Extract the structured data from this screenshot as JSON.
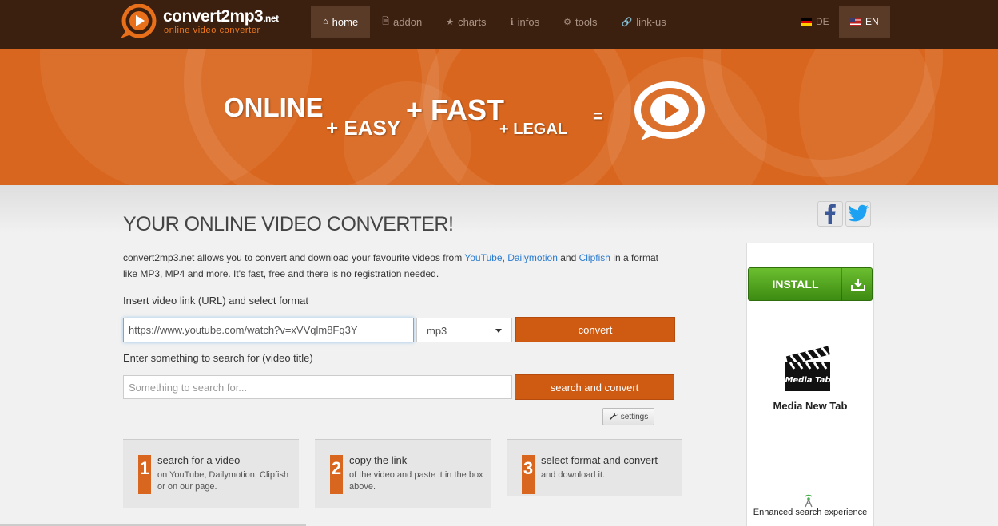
{
  "brand": {
    "name": "convert2mp3",
    "tld": ".net",
    "tagline": "online video converter",
    "color_primary": "#d9661e",
    "color_dark": "#3b1f0f"
  },
  "nav": {
    "items": [
      {
        "label": "home",
        "icon": "home-icon",
        "active": true
      },
      {
        "label": "addon",
        "icon": "file-icon"
      },
      {
        "label": "charts",
        "icon": "star-icon"
      },
      {
        "label": "infos",
        "icon": "info-icon"
      },
      {
        "label": "tools",
        "icon": "cogs-icon"
      },
      {
        "label": "link-us",
        "icon": "link-icon"
      }
    ],
    "lang_de": "DE",
    "lang_en": "EN"
  },
  "banner": {
    "w1": "ONLINE",
    "w2": "+ EASY",
    "w3": "+ FAST",
    "w4": "+ LEGAL",
    "w5": "="
  },
  "main": {
    "heading": "YOUR ONLINE VIDEO CONVERTER!",
    "intro_pre": "convert2mp3.net allows you to convert and download your favourite videos from ",
    "link_youtube": "YouTube",
    "comma": ", ",
    "link_dailymotion": "Dailymotion",
    "and": " and ",
    "link_clipfish": "Clipfish",
    "intro_post": " in a format like MP3, MP4 and more. It's fast, free and there is no registration needed.",
    "url_label": "Insert video link (URL) and select format",
    "url_value": "https://www.youtube.com/watch?v=xVVqlm8Fq3Y",
    "format_value": "mp3",
    "convert_label": "convert",
    "search_label": "Enter something to search for (video title)",
    "search_placeholder": "Something to search for...",
    "search_button": "search and convert",
    "settings_label": "settings"
  },
  "steps": [
    {
      "num": "1",
      "title": "search for a video",
      "desc": "on YouTube, Dailymotion, Clipfish or on our page."
    },
    {
      "num": "2",
      "title": "copy the link",
      "desc": "of the video and paste it in the box above."
    },
    {
      "num": "3",
      "title": "select format and convert",
      "desc": "and download it."
    }
  ],
  "ad": {
    "install_label": "INSTALL",
    "clapper_text": "Media Tab",
    "title": "Media New Tab",
    "footer": "Enhanced search experience"
  }
}
